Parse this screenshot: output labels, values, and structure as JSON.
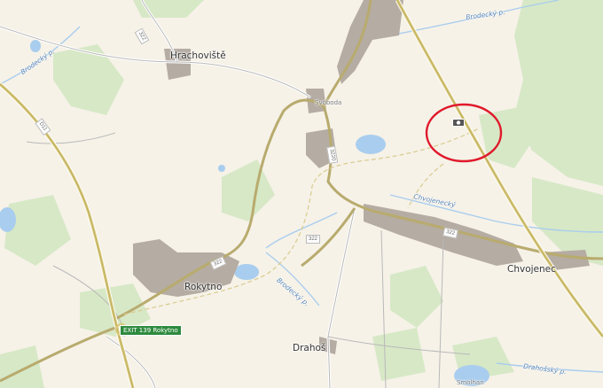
{
  "map": {
    "places": {
      "hrachoviste": "Hrachoviště",
      "rokytno": "Rokytno",
      "chvojenec": "Chvojenec",
      "drahos": "Drahoš",
      "svoboda": "Svoboda",
      "smolhan": "Smolhan"
    },
    "streams": {
      "brodecky_top": "Brodecký p.",
      "chrojanecky": "Chvojenecký",
      "brodecky_mid": "Brodecký p.",
      "drahosky": "Drahošský p.",
      "left_stream": "Brodecký p."
    },
    "exit_badge": "EXIT 139 Rokytno",
    "road_shields": [
      "D11",
      "322",
      "322",
      "322",
      "3220",
      "322"
    ],
    "highlight_circle_color": "#e0192b",
    "colors": {
      "land": "#f6f2e8",
      "forest": "#d7e8c6",
      "water": "#a9cdee",
      "motorway": "#d8c878",
      "road": "#b8ab6e",
      "built_up": "#b5aca3",
      "exit_green": "#2e8a3e"
    },
    "icons": [
      "camera-icon"
    ]
  }
}
